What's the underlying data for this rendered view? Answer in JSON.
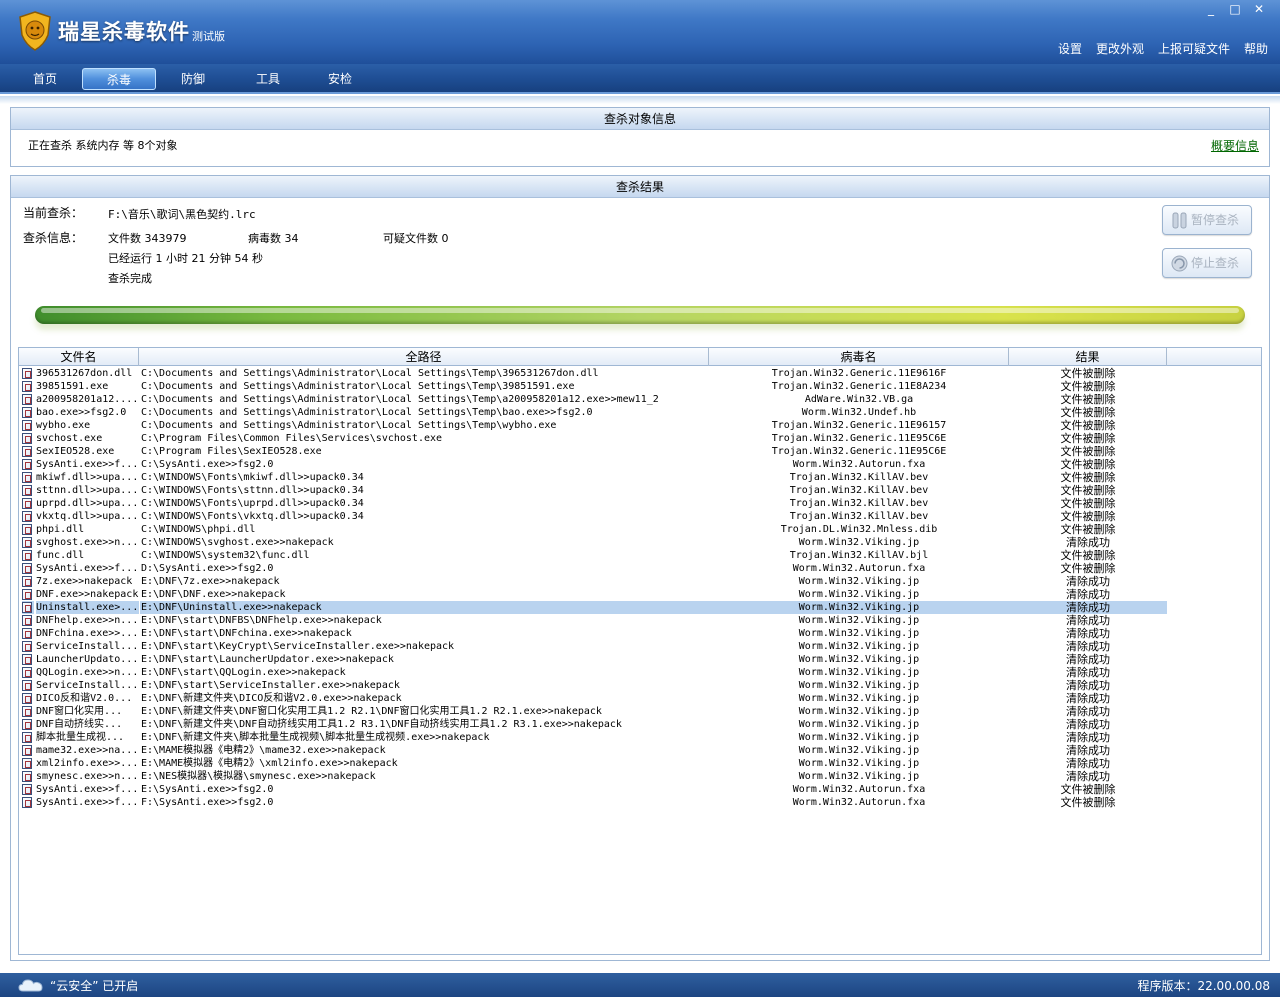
{
  "app": {
    "name": "瑞星杀毒软件",
    "edition": "测试版",
    "window_controls": [
      "_",
      "□",
      "✕"
    ]
  },
  "top_links": [
    "设置",
    "更改外观",
    "上报可疑文件",
    "帮助"
  ],
  "nav": {
    "tabs": [
      "首页",
      "杀毒",
      "防御",
      "工具",
      "安检"
    ],
    "active": "杀毒"
  },
  "scan_target_panel": {
    "title": "查杀对象信息",
    "status": "正在查杀 系统内存 等 8个对象",
    "summary_link": "概要信息"
  },
  "results_panel": {
    "title": "查杀结果",
    "current_label": "当前查杀：",
    "current_file": "F:\\音乐\\歌词\\黑色契约.lrc",
    "info_label": "查杀信息：",
    "file_count": "文件数 343979",
    "virus_count": "病毒数 34",
    "suspicious_count": "可疑文件数 0",
    "elapsed": "已经运行 1 小时 21 分钟 54  秒",
    "done": "查杀完成",
    "pause_button": "暂停查杀",
    "stop_button": "停止查杀",
    "progress": 1.0
  },
  "table": {
    "columns": [
      "文件名",
      "全路径",
      "病毒名",
      "结果",
      ""
    ],
    "rows": [
      {
        "name": "396531267don.dll",
        "path": "C:\\Documents and Settings\\Administrator\\Local Settings\\Temp\\396531267don.dll",
        "virus": "Trojan.Win32.Generic.11E9616F",
        "result": "文件被删除"
      },
      {
        "name": "39851591.exe",
        "path": "C:\\Documents and Settings\\Administrator\\Local Settings\\Temp\\39851591.exe",
        "virus": "Trojan.Win32.Generic.11E8A234",
        "result": "文件被删除"
      },
      {
        "name": "a200958201a12....",
        "path": "C:\\Documents and Settings\\Administrator\\Local Settings\\Temp\\a200958201a12.exe>>mew11_2",
        "virus": "AdWare.Win32.VB.ga",
        "result": "文件被删除"
      },
      {
        "name": "bao.exe>>fsg2.0",
        "path": "C:\\Documents and Settings\\Administrator\\Local Settings\\Temp\\bao.exe>>fsg2.0",
        "virus": "Worm.Win32.Undef.hb",
        "result": "文件被删除"
      },
      {
        "name": "wybho.exe",
        "path": "C:\\Documents and Settings\\Administrator\\Local Settings\\Temp\\wybho.exe",
        "virus": "Trojan.Win32.Generic.11E96157",
        "result": "文件被删除"
      },
      {
        "name": "svchost.exe",
        "path": "C:\\Program Files\\Common Files\\Services\\svchost.exe",
        "virus": "Trojan.Win32.Generic.11E95C6E",
        "result": "文件被删除"
      },
      {
        "name": "SexIEO528.exe",
        "path": "C:\\Program Files\\SexIEO528.exe",
        "virus": "Trojan.Win32.Generic.11E95C6E",
        "result": "文件被删除"
      },
      {
        "name": "SysAnti.exe>>f...",
        "path": "C:\\SysAnti.exe>>fsg2.0",
        "virus": "Worm.Win32.Autorun.fxa",
        "result": "文件被删除"
      },
      {
        "name": "mkiwf.dll>>upa...",
        "path": "C:\\WINDOWS\\Fonts\\mkiwf.dll>>upack0.34",
        "virus": "Trojan.Win32.KillAV.bev",
        "result": "文件被删除"
      },
      {
        "name": "sttnn.dll>>upa...",
        "path": "C:\\WINDOWS\\Fonts\\sttnn.dll>>upack0.34",
        "virus": "Trojan.Win32.KillAV.bev",
        "result": "文件被删除"
      },
      {
        "name": "uprpd.dll>>upa...",
        "path": "C:\\WINDOWS\\Fonts\\uprpd.dll>>upack0.34",
        "virus": "Trojan.Win32.KillAV.bev",
        "result": "文件被删除"
      },
      {
        "name": "vkxtq.dll>>upa...",
        "path": "C:\\WINDOWS\\Fonts\\vkxtq.dll>>upack0.34",
        "virus": "Trojan.Win32.KillAV.bev",
        "result": "文件被删除"
      },
      {
        "name": "phpi.dll",
        "path": "C:\\WINDOWS\\phpi.dll",
        "virus": "Trojan.DL.Win32.Mnless.dib",
        "result": "文件被删除"
      },
      {
        "name": "svghost.exe>>n...",
        "path": "C:\\WINDOWS\\svghost.exe>>nakepack",
        "virus": "Worm.Win32.Viking.jp",
        "result": "清除成功"
      },
      {
        "name": "func.dll",
        "path": "C:\\WINDOWS\\system32\\func.dll",
        "virus": "Trojan.Win32.KillAV.bjl",
        "result": "文件被删除"
      },
      {
        "name": "SysAnti.exe>>f...",
        "path": "D:\\SysAnti.exe>>fsg2.0",
        "virus": "Worm.Win32.Autorun.fxa",
        "result": "文件被删除"
      },
      {
        "name": "7z.exe>>nakepack",
        "path": "E:\\DNF\\7z.exe>>nakepack",
        "virus": "Worm.Win32.Viking.jp",
        "result": "清除成功"
      },
      {
        "name": "DNF.exe>>nakepack",
        "path": "E:\\DNF\\DNF.exe>>nakepack",
        "virus": "Worm.Win32.Viking.jp",
        "result": "清除成功"
      },
      {
        "name": "Uninstall.exe>...",
        "path": "E:\\DNF\\Uninstall.exe>>nakepack",
        "virus": "Worm.Win32.Viking.jp",
        "result": "清除成功",
        "selected": true
      },
      {
        "name": "DNFhelp.exe>>n...",
        "path": "E:\\DNF\\start\\DNFBS\\DNFhelp.exe>>nakepack",
        "virus": "Worm.Win32.Viking.jp",
        "result": "清除成功"
      },
      {
        "name": "DNFchina.exe>>...",
        "path": "E:\\DNF\\start\\DNFchina.exe>>nakepack",
        "virus": "Worm.Win32.Viking.jp",
        "result": "清除成功"
      },
      {
        "name": "ServiceInstall...",
        "path": "E:\\DNF\\start\\KeyCrypt\\ServiceInstaller.exe>>nakepack",
        "virus": "Worm.Win32.Viking.jp",
        "result": "清除成功"
      },
      {
        "name": "LauncherUpdato...",
        "path": "E:\\DNF\\start\\LauncherUpdator.exe>>nakepack",
        "virus": "Worm.Win32.Viking.jp",
        "result": "清除成功"
      },
      {
        "name": "QQLogin.exe>>n...",
        "path": "E:\\DNF\\start\\QQLogin.exe>>nakepack",
        "virus": "Worm.Win32.Viking.jp",
        "result": "清除成功"
      },
      {
        "name": "ServiceInstall...",
        "path": "E:\\DNF\\start\\ServiceInstaller.exe>>nakepack",
        "virus": "Worm.Win32.Viking.jp",
        "result": "清除成功"
      },
      {
        "name": "DICO反和谐V2.0...",
        "path": "E:\\DNF\\新建文件夹\\DICO反和谐V2.0.exe>>nakepack",
        "virus": "Worm.Win32.Viking.jp",
        "result": "清除成功"
      },
      {
        "name": "DNF窗口化实用...",
        "path": "E:\\DNF\\新建文件夹\\DNF窗口化实用工具1.2 R2.1\\DNF窗口化实用工具1.2 R2.1.exe>>nakepack",
        "virus": "Worm.Win32.Viking.jp",
        "result": "清除成功"
      },
      {
        "name": "DNF自动挤线实...",
        "path": "E:\\DNF\\新建文件夹\\DNF自动挤线实用工具1.2 R3.1\\DNF自动挤线实用工具1.2 R3.1.exe>>nakepack",
        "virus": "Worm.Win32.Viking.jp",
        "result": "清除成功"
      },
      {
        "name": "脚本批量生成视...",
        "path": "E:\\DNF\\新建文件夹\\脚本批量生成视频\\脚本批量生成视频.exe>>nakepack",
        "virus": "Worm.Win32.Viking.jp",
        "result": "清除成功"
      },
      {
        "name": "mame32.exe>>na...",
        "path": "E:\\MAME模拟器《电精2》\\mame32.exe>>nakepack",
        "virus": "Worm.Win32.Viking.jp",
        "result": "清除成功"
      },
      {
        "name": "xml2info.exe>>...",
        "path": "E:\\MAME模拟器《电精2》\\xml2info.exe>>nakepack",
        "virus": "Worm.Win32.Viking.jp",
        "result": "清除成功"
      },
      {
        "name": "smynesc.exe>>n...",
        "path": "E:\\NES模拟器\\模拟器\\smynesc.exe>>nakepack",
        "virus": "Worm.Win32.Viking.jp",
        "result": "清除成功"
      },
      {
        "name": "SysAnti.exe>>f...",
        "path": "E:\\SysAnti.exe>>fsg2.0",
        "virus": "Worm.Win32.Autorun.fxa",
        "result": "文件被删除"
      },
      {
        "name": "SysAnti.exe>>f...",
        "path": "F:\\SysAnti.exe>>fsg2.0",
        "virus": "Worm.Win32.Autorun.fxa",
        "result": "文件被删除"
      }
    ]
  },
  "statusbar": {
    "cloud": "“云安全” 已开启",
    "version": "程序版本：22.00.00.08"
  }
}
